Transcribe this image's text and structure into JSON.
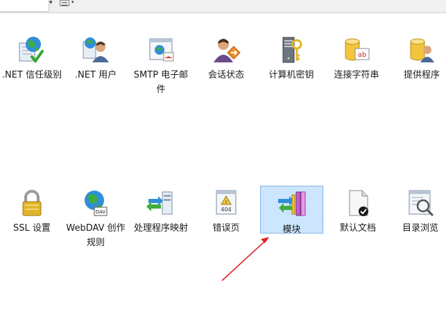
{
  "row1": {
    "items": [
      {
        "label": ".NET 信任级别",
        "icon": "trust-globe-check-icon"
      },
      {
        "label": ".NET 用户",
        "icon": "users-icon"
      },
      {
        "label": "SMTP 电子邮件",
        "icon": "smtp-mail-icon"
      },
      {
        "label": "会话状态",
        "icon": "session-state-icon"
      },
      {
        "label": "计算机密钥",
        "icon": "machine-key-icon"
      },
      {
        "label": "连接字符串",
        "icon": "connection-string-icon"
      },
      {
        "label": "提供程序",
        "icon": "providers-icon"
      }
    ]
  },
  "row2": {
    "items": [
      {
        "label": "SSL 设置",
        "icon": "padlock-icon"
      },
      {
        "label": "WebDAV 创作规则",
        "icon": "webdav-globe-icon"
      },
      {
        "label": "处理程序映射",
        "icon": "handler-mappings-icon"
      },
      {
        "label": "错误页",
        "icon": "error-page-404-icon"
      },
      {
        "label": "模块",
        "icon": "modules-icon",
        "selected": true
      },
      {
        "label": "默认文档",
        "icon": "default-document-icon"
      },
      {
        "label": "目录浏览",
        "icon": "directory-browsing-icon"
      }
    ]
  },
  "annotation": {
    "icon": "red-arrow-icon",
    "color": "#e02020"
  },
  "colors": {
    "selection_bg": "#cce6ff",
    "selection_border": "#3c7fc1"
  }
}
